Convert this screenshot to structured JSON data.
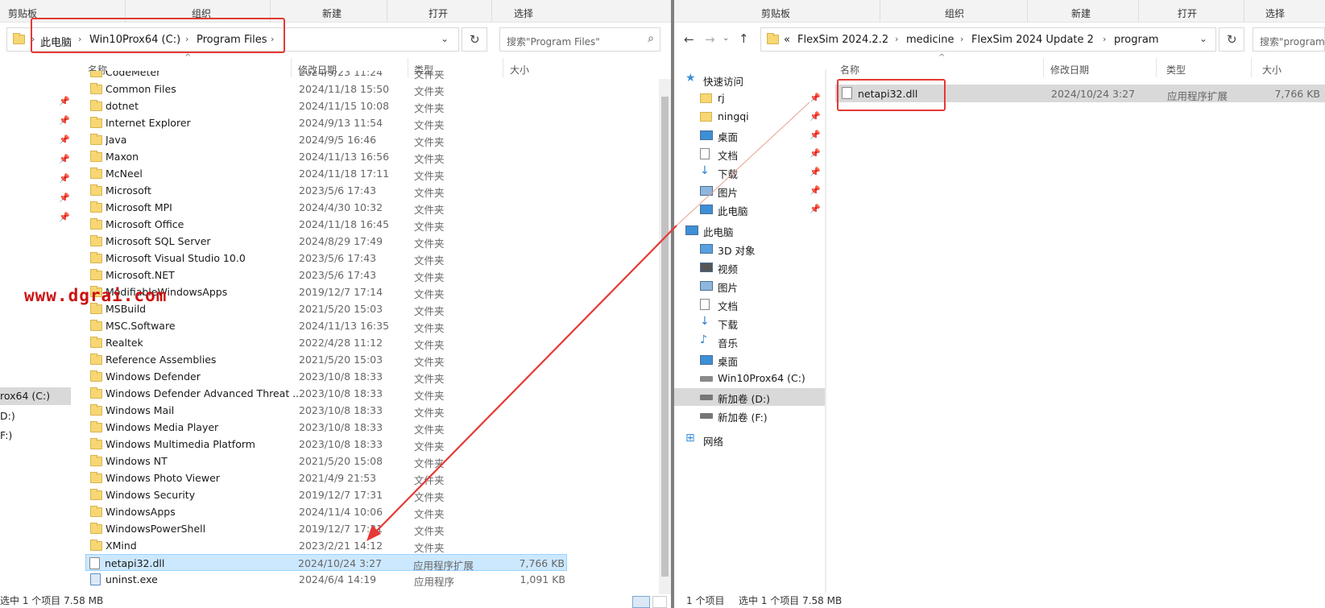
{
  "left": {
    "ribbon": [
      "剪贴板",
      "组织",
      "新建",
      "打开",
      "选择"
    ],
    "breadcrumb": [
      "此电脑",
      "Win10Prox64 (C:)",
      "Program Files"
    ],
    "search_placeholder": "搜索\"Program Files\"",
    "columns": {
      "name": "名称",
      "date": "修改日期",
      "type": "类型",
      "size": "大小"
    },
    "rows": [
      {
        "name": "CodeMeter",
        "date": "2024/9/23 11:24",
        "type": "文件夹",
        "size": "",
        "kind": "folder"
      },
      {
        "name": "Common Files",
        "date": "2024/11/18 15:50",
        "type": "文件夹",
        "size": "",
        "kind": "folder"
      },
      {
        "name": "dotnet",
        "date": "2024/11/15 10:08",
        "type": "文件夹",
        "size": "",
        "kind": "folder"
      },
      {
        "name": "Internet Explorer",
        "date": "2024/9/13 11:54",
        "type": "文件夹",
        "size": "",
        "kind": "folder"
      },
      {
        "name": "Java",
        "date": "2024/9/5 16:46",
        "type": "文件夹",
        "size": "",
        "kind": "folder"
      },
      {
        "name": "Maxon",
        "date": "2024/11/13 16:56",
        "type": "文件夹",
        "size": "",
        "kind": "folder"
      },
      {
        "name": "McNeel",
        "date": "2024/11/18 17:11",
        "type": "文件夹",
        "size": "",
        "kind": "folder"
      },
      {
        "name": "Microsoft",
        "date": "2023/5/6 17:43",
        "type": "文件夹",
        "size": "",
        "kind": "folder"
      },
      {
        "name": "Microsoft MPI",
        "date": "2024/4/30 10:32",
        "type": "文件夹",
        "size": "",
        "kind": "folder"
      },
      {
        "name": "Microsoft Office",
        "date": "2024/11/18 16:45",
        "type": "文件夹",
        "size": "",
        "kind": "folder"
      },
      {
        "name": "Microsoft SQL Server",
        "date": "2024/8/29 17:49",
        "type": "文件夹",
        "size": "",
        "kind": "folder"
      },
      {
        "name": "Microsoft Visual Studio 10.0",
        "date": "2023/5/6 17:43",
        "type": "文件夹",
        "size": "",
        "kind": "folder"
      },
      {
        "name": "Microsoft.NET",
        "date": "2023/5/6 17:43",
        "type": "文件夹",
        "size": "",
        "kind": "folder"
      },
      {
        "name": "ModifiableWindowsApps",
        "date": "2019/12/7 17:14",
        "type": "文件夹",
        "size": "",
        "kind": "folder"
      },
      {
        "name": "MSBuild",
        "date": "2021/5/20 15:03",
        "type": "文件夹",
        "size": "",
        "kind": "folder"
      },
      {
        "name": "MSC.Software",
        "date": "2024/11/13 16:35",
        "type": "文件夹",
        "size": "",
        "kind": "folder"
      },
      {
        "name": "Realtek",
        "date": "2022/4/28 11:12",
        "type": "文件夹",
        "size": "",
        "kind": "folder"
      },
      {
        "name": "Reference Assemblies",
        "date": "2021/5/20 15:03",
        "type": "文件夹",
        "size": "",
        "kind": "folder"
      },
      {
        "name": "Windows Defender",
        "date": "2023/10/8 18:33",
        "type": "文件夹",
        "size": "",
        "kind": "folder"
      },
      {
        "name": "Windows Defender Advanced Threat ...",
        "date": "2023/10/8 18:33",
        "type": "文件夹",
        "size": "",
        "kind": "folder"
      },
      {
        "name": "Windows Mail",
        "date": "2023/10/8 18:33",
        "type": "文件夹",
        "size": "",
        "kind": "folder"
      },
      {
        "name": "Windows Media Player",
        "date": "2023/10/8 18:33",
        "type": "文件夹",
        "size": "",
        "kind": "folder"
      },
      {
        "name": "Windows Multimedia Platform",
        "date": "2023/10/8 18:33",
        "type": "文件夹",
        "size": "",
        "kind": "folder"
      },
      {
        "name": "Windows NT",
        "date": "2021/5/20 15:08",
        "type": "文件夹",
        "size": "",
        "kind": "folder"
      },
      {
        "name": "Windows Photo Viewer",
        "date": "2021/4/9 21:53",
        "type": "文件夹",
        "size": "",
        "kind": "folder"
      },
      {
        "name": "Windows Security",
        "date": "2019/12/7 17:31",
        "type": "文件夹",
        "size": "",
        "kind": "folder"
      },
      {
        "name": "WindowsApps",
        "date": "2024/11/4 10:06",
        "type": "文件夹",
        "size": "",
        "kind": "folder"
      },
      {
        "name": "WindowsPowerShell",
        "date": "2019/12/7 17:31",
        "type": "文件夹",
        "size": "",
        "kind": "folder"
      },
      {
        "name": "XMind",
        "date": "2023/2/21 14:12",
        "type": "文件夹",
        "size": "",
        "kind": "folder"
      },
      {
        "name": "netapi32.dll",
        "date": "2024/10/24 3:27",
        "type": "应用程序扩展",
        "size": "7,766 KB",
        "kind": "dll",
        "selected": true
      },
      {
        "name": "uninst.exe",
        "date": "2024/6/4 14:19",
        "type": "应用程序",
        "size": "1,091 KB",
        "kind": "exe"
      }
    ],
    "nav_partial": [
      "rox64 (C:)",
      "D:)",
      "F:)"
    ],
    "status": "选中 1 个项目  7.58 MB"
  },
  "right": {
    "ribbon": [
      "剪贴板",
      "组织",
      "新建",
      "打开",
      "选择"
    ],
    "breadcrumb": [
      "«",
      "FlexSim 2024.2.2",
      "medicine",
      "FlexSim 2024 Update 2",
      "program"
    ],
    "search_placeholder": "搜索\"program\"",
    "columns": {
      "name": "名称",
      "date": "修改日期",
      "type": "类型",
      "size": "大小"
    },
    "rows": [
      {
        "name": "netapi32.dll",
        "date": "2024/10/24 3:27",
        "type": "应用程序扩展",
        "size": "7,766 KB"
      }
    ],
    "nav": [
      {
        "label": "快速访问",
        "icon": "star-icon",
        "pinned": false
      },
      {
        "label": "rj",
        "icon": "folder-icon",
        "pinned": true
      },
      {
        "label": "ningqi",
        "icon": "folder-icon",
        "pinned": true
      },
      {
        "label": "桌面",
        "icon": "desktop-icon",
        "pinned": true
      },
      {
        "label": "文档",
        "icon": "document-icon",
        "pinned": true
      },
      {
        "label": "下载",
        "icon": "download-icon",
        "pinned": true
      },
      {
        "label": "图片",
        "icon": "pictures-icon",
        "pinned": true
      },
      {
        "label": "此电脑",
        "icon": "monitor-icon",
        "pinned": true
      },
      {
        "label": "此电脑",
        "icon": "monitor-icon",
        "pinned": false
      },
      {
        "label": "3D 对象",
        "icon": "3d-objects-icon",
        "pinned": false
      },
      {
        "label": "视频",
        "icon": "video-icon",
        "pinned": false
      },
      {
        "label": "图片",
        "icon": "pictures-icon",
        "pinned": false
      },
      {
        "label": "文档",
        "icon": "document-icon",
        "pinned": false
      },
      {
        "label": "下载",
        "icon": "download-icon",
        "pinned": false
      },
      {
        "label": "音乐",
        "icon": "music-icon",
        "pinned": false
      },
      {
        "label": "桌面",
        "icon": "desktop-icon",
        "pinned": false
      },
      {
        "label": "Win10Prox64 (C:)",
        "icon": "drive-c-icon",
        "pinned": false
      },
      {
        "label": "新加卷 (D:)",
        "icon": "drive-icon",
        "pinned": false,
        "selected": true
      },
      {
        "label": "新加卷 (F:)",
        "icon": "drive-icon",
        "pinned": false
      },
      {
        "label": "网络",
        "icon": "network-icon",
        "pinned": false
      }
    ],
    "status_left": "1 个项目",
    "status_right": "选中 1 个项目  7.58 MB"
  },
  "watermark": "www.dgrai.com",
  "colors": {
    "highlight": "#e53935",
    "selection": "#cce8ff"
  }
}
